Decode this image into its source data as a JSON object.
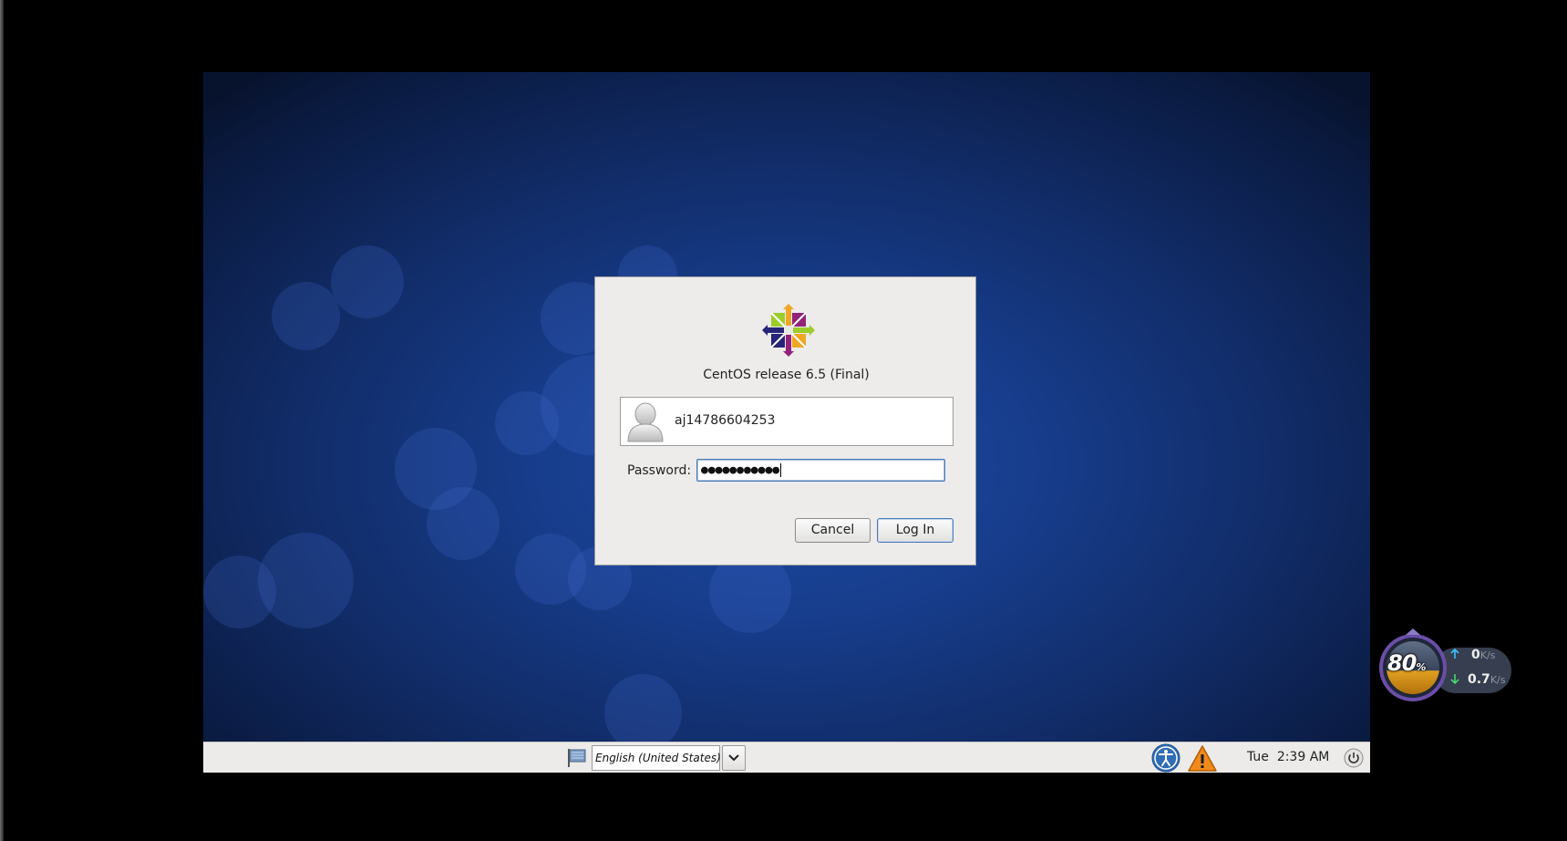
{
  "login_dialog": {
    "release_text": "CentOS release 6.5 (Final)",
    "username": "aj14786604253",
    "password_label": "Password:",
    "password_masked": "●●●●●●●●●●●",
    "cancel_label": "Cancel",
    "login_label": "Log In"
  },
  "taskbar": {
    "language": "English (United States)",
    "clock": "Tue  2:39 AM",
    "icons": [
      "language-flag-icon",
      "chevron-down-icon",
      "accessibility-icon",
      "warning-icon",
      "power-icon"
    ]
  },
  "network_widget": {
    "percent": "80",
    "percent_symbol": "%",
    "upload_value": "0",
    "download_value": "0.7",
    "unit": "K/s",
    "icons": [
      "upload-arrow-icon",
      "download-arrow-icon"
    ]
  },
  "colors": {
    "desktop_center": "#1d4aa3",
    "desktop_edge": "#07122d",
    "dialog_bg": "#edeceb",
    "focus_border": "#4a79b5",
    "taskbar_bg": "#ecebe9"
  }
}
